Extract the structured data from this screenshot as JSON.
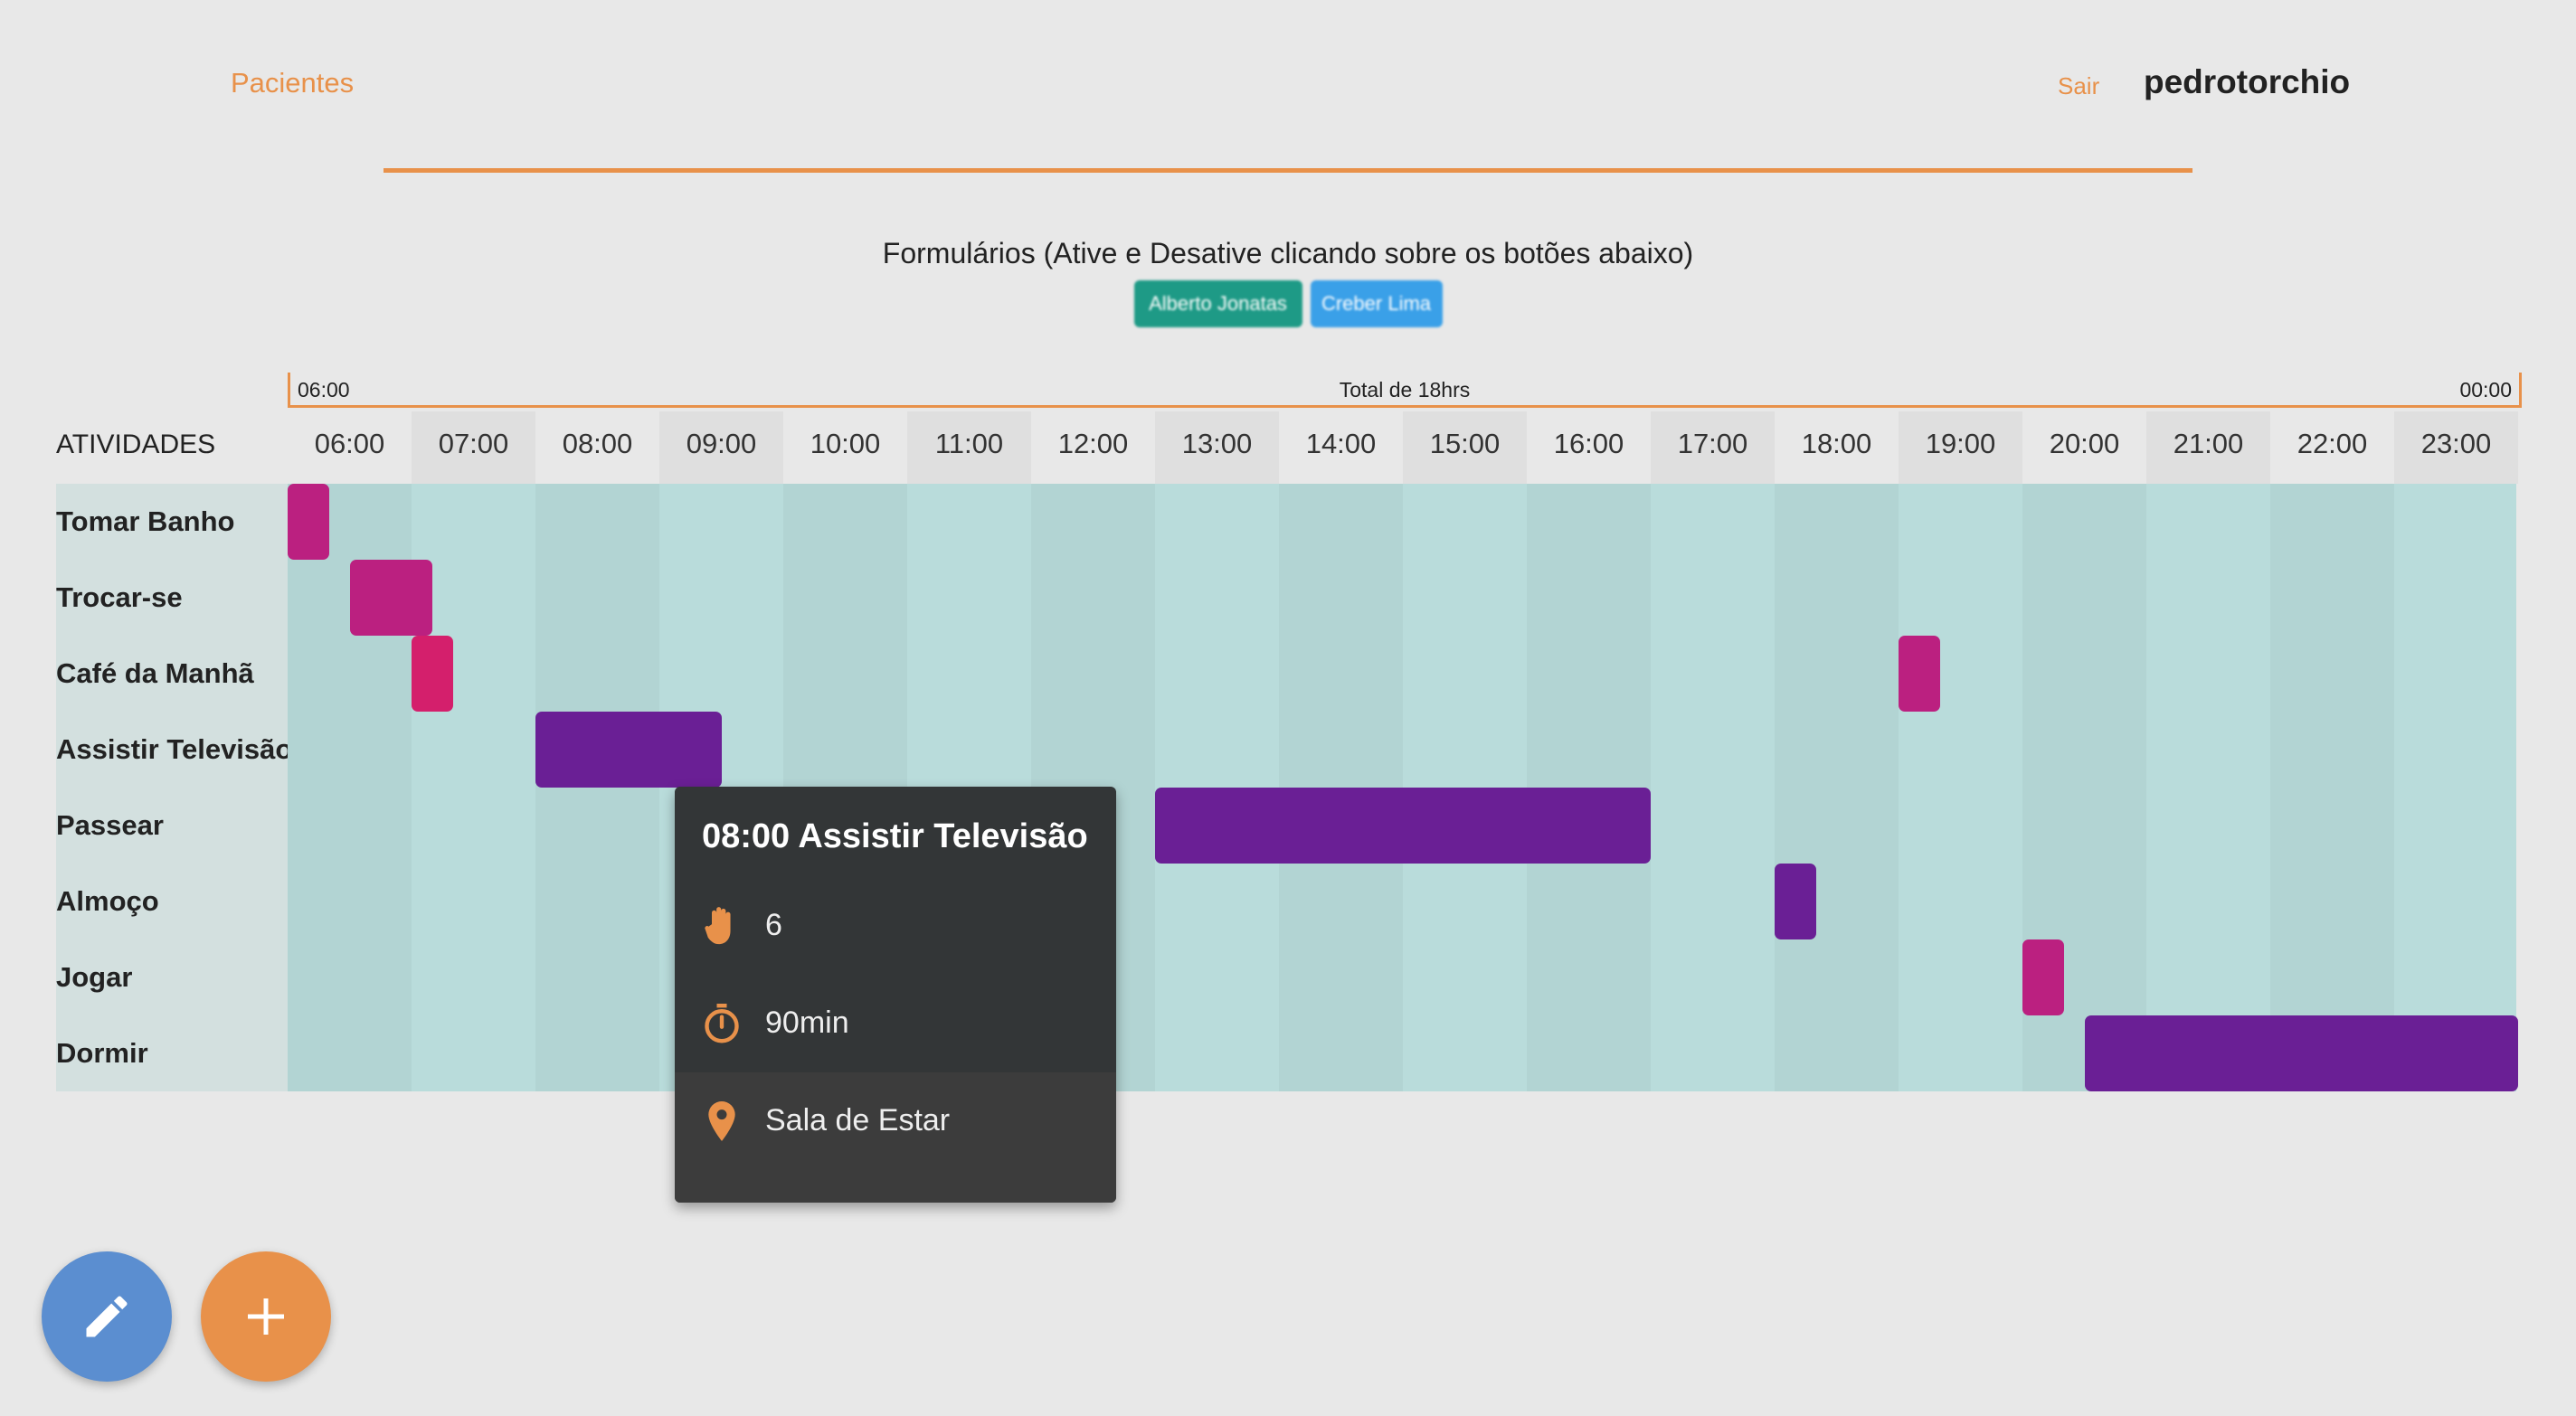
{
  "nav": {
    "pacientes": "Pacientes",
    "sair": "Sair",
    "username": "pedrotorchio"
  },
  "forms": {
    "title": "Formulários (Ative e Desative clicando sobre os botões abaixo)",
    "buttons": [
      {
        "label": "Alberto Jonatas",
        "color": "#1e9a86"
      },
      {
        "label": "Creber Lima",
        "color": "#3aa0e8"
      }
    ]
  },
  "timeline": {
    "start": "06:00",
    "total": "Total de 18hrs",
    "end": "00:00"
  },
  "schedule": {
    "header_label": "ATIVIDADES",
    "hours": [
      "06:00",
      "07:00",
      "08:00",
      "09:00",
      "10:00",
      "11:00",
      "12:00",
      "13:00",
      "14:00",
      "15:00",
      "16:00",
      "17:00",
      "18:00",
      "19:00",
      "20:00",
      "21:00",
      "22:00",
      "23:00"
    ],
    "activities": [
      {
        "name": "Tomar Banho",
        "blocks": [
          {
            "start": "06:00",
            "end": "06:20",
            "color": "#bb2080"
          }
        ]
      },
      {
        "name": "Trocar-se",
        "blocks": [
          {
            "start": "06:30",
            "end": "07:10",
            "color": "#bb2080"
          }
        ]
      },
      {
        "name": "Café da Manhã",
        "blocks": [
          {
            "start": "07:00",
            "end": "07:20",
            "color": "#d41f6c"
          },
          {
            "start": "19:00",
            "end": "19:20",
            "color": "#bb2080"
          }
        ]
      },
      {
        "name": "Assistir Televisão",
        "blocks": [
          {
            "start": "08:00",
            "end": "09:30",
            "color": "#6a1f95"
          }
        ]
      },
      {
        "name": "Passear",
        "blocks": [
          {
            "start": "13:00",
            "end": "17:00",
            "color": "#6a1f95"
          }
        ]
      },
      {
        "name": "Almoço",
        "blocks": [
          {
            "start": "18:00",
            "end": "18:20",
            "color": "#6a1f95"
          }
        ]
      },
      {
        "name": "Jogar",
        "blocks": [
          {
            "start": "20:00",
            "end": "20:20",
            "color": "#bb2080"
          }
        ]
      },
      {
        "name": "Dormir",
        "blocks": [
          {
            "start": "20:30",
            "end": "24:00",
            "color": "#6a1f95"
          }
        ]
      }
    ]
  },
  "tooltip": {
    "title": "08:00 Assistir Televisão",
    "count": "6",
    "duration": "90min",
    "location": "Sala de Estar",
    "icons": [
      "hand-icon",
      "timer-icon",
      "location-pin-icon"
    ],
    "accent": "#e8914a"
  },
  "fabs": {
    "edit_icon": "pencil-icon",
    "add_icon": "plus-icon"
  }
}
